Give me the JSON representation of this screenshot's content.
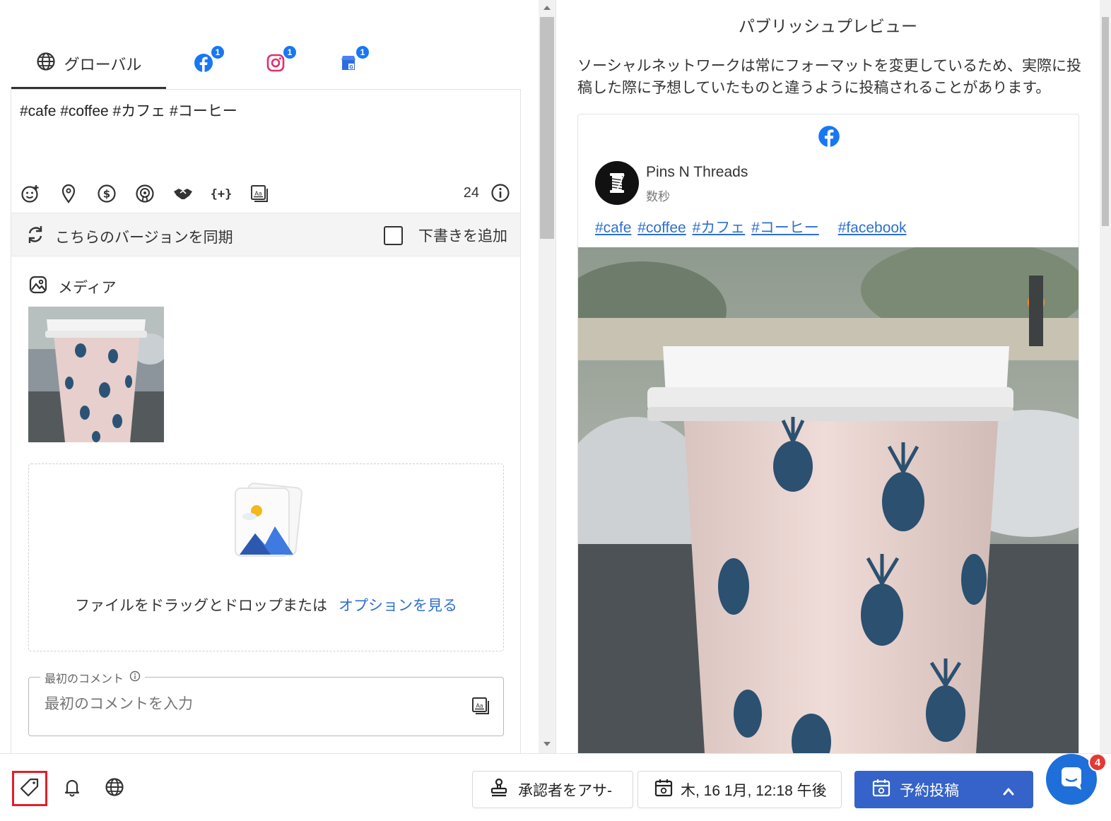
{
  "tabs": {
    "global_label": "グローバル",
    "facebook_badge": "1",
    "instagram_badge": "1",
    "gbusiness_badge": "1"
  },
  "editor": {
    "post_text": "#cafe #coffee #カフェ #コーヒー",
    "char_count": "24",
    "toolbar_icons": [
      "emoji-icon",
      "location-icon",
      "dollar-icon",
      "podcast-icon",
      "handshake-icon",
      "variable-icon",
      "media-library-icon"
    ],
    "sync_label": "こちらのバージョンを同期",
    "draft_label": "下書きを追加",
    "draft_checked": false
  },
  "media": {
    "heading": "メディア",
    "drop_text": "ファイルをドラッグとドロップまたは",
    "drop_link": "オプションを見る"
  },
  "first_comment": {
    "legend": "最初のコメント",
    "placeholder": "最初のコメントを入力"
  },
  "preview": {
    "title": "パブリッシュプレビュー",
    "note": "ソーシャルネットワークは常にフォーマットを変更しているため、実際に投稿した際に予想していたものと違うように投稿されることがあります。",
    "account_name": "Pins N Threads",
    "time": "数秒",
    "hashtags": [
      "#cafe",
      "#coffee",
      "#カフェ",
      "#コーヒー"
    ],
    "extra_hashtag": "#facebook"
  },
  "bottom": {
    "approver_label": "承認者をアサ-",
    "date_label": "木, 16 1月, 12:18 午後",
    "schedule_label": "予約投稿",
    "chat_badge": "4"
  },
  "colors": {
    "accent": "#3563c9",
    "facebook": "#1877f2",
    "link": "#2e6fcf",
    "highlight_border": "#e0202a"
  }
}
